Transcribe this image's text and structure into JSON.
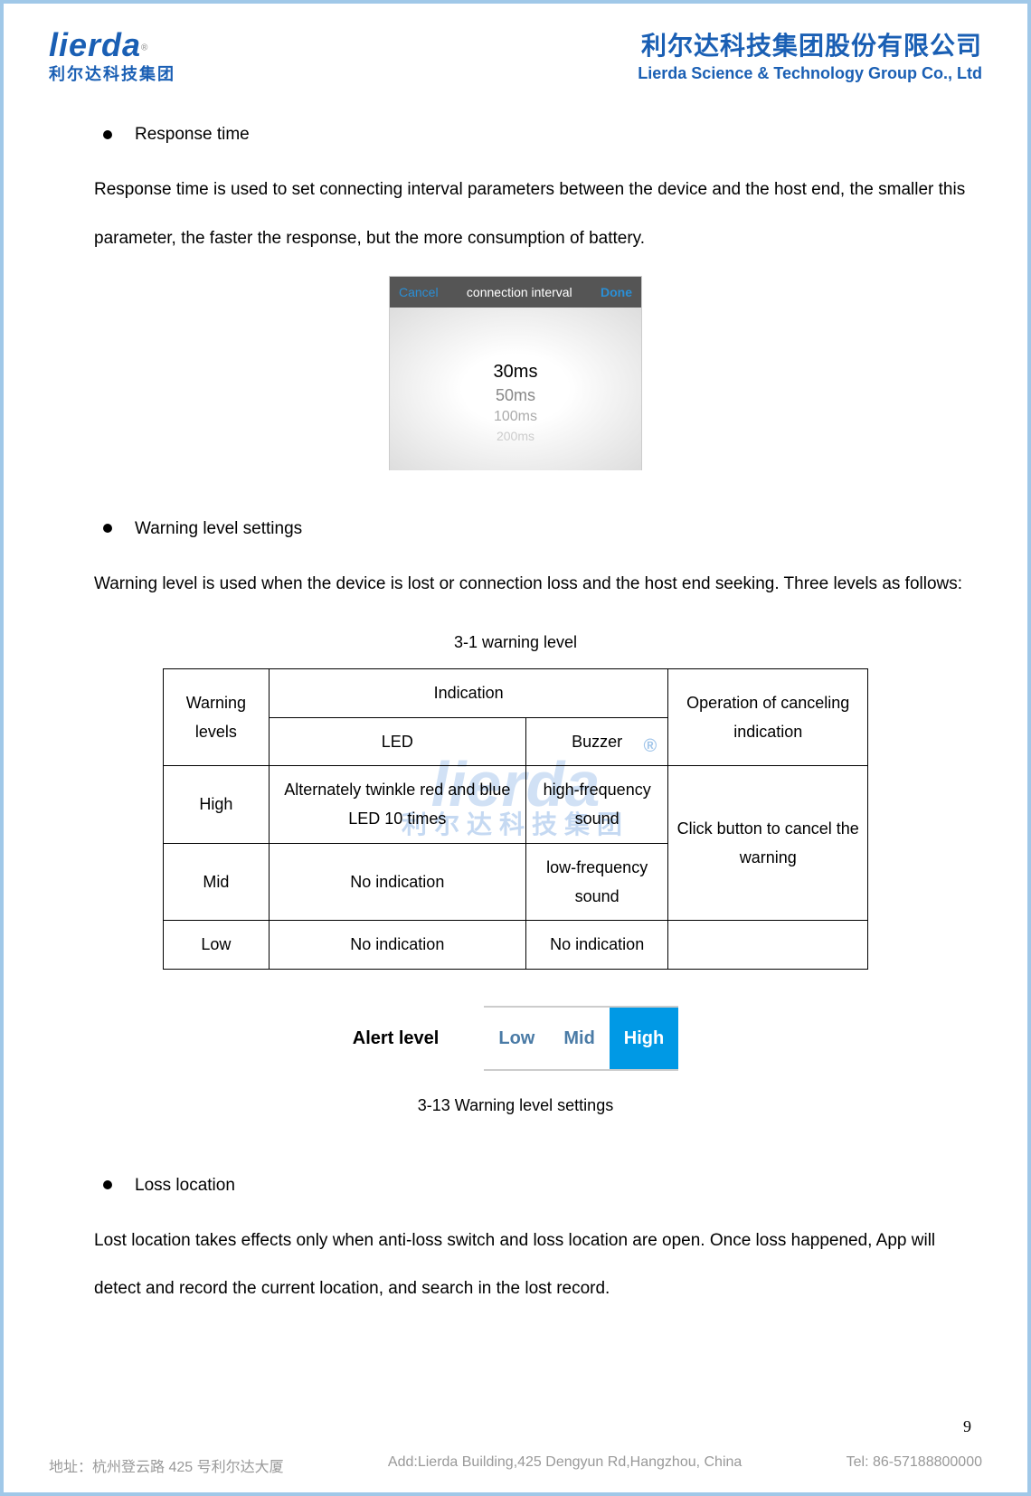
{
  "header": {
    "logo_text": "lierda",
    "logo_sub": "利尔达科技集团",
    "company_cn": "利尔达科技集团股份有限公司",
    "company_en": "Lierda Science & Technology Group Co., Ltd"
  },
  "section1": {
    "title": "Response time",
    "para": "Response time is used to set connecting interval parameters between the device and the host end, the smaller this parameter, the faster the response, but the more consumption of battery."
  },
  "phone": {
    "cancel": "Cancel",
    "title": "connection interval",
    "done": "Done",
    "options": [
      "30ms",
      "50ms",
      "100ms",
      "200ms"
    ]
  },
  "section2": {
    "title": "Warning level settings",
    "para": "Warning level is used when the device is lost or connection loss and the host end seeking. Three levels as follows:",
    "table_caption": "3-1   warning level",
    "table": {
      "headers": {
        "c1": "Warning levels",
        "c2": "Indication",
        "c2a": "LED",
        "c2b": "Buzzer",
        "c3": "Operation of canceling indication"
      },
      "rows": [
        {
          "level": "High",
          "led": "Alternately twinkle red and blue LED 10 times",
          "buzzer": "high-frequency sound",
          "op": "Click button to cancel the warning"
        },
        {
          "level": "Mid",
          "led": "No indication",
          "buzzer": "low-frequency sound"
        },
        {
          "level": "Low",
          "led": "No indication",
          "buzzer": "No indication",
          "op": ""
        }
      ]
    }
  },
  "alert": {
    "label": "Alert level",
    "low": "Low",
    "mid": "Mid",
    "high": "High"
  },
  "fig_caption": "3-13  Warning level settings",
  "section3": {
    "title": "Loss location",
    "para": "Lost location takes effects only when anti-loss switch and loss location are open. Once loss happened, App will detect and record the current location, and search in the lost record."
  },
  "page_num": "9",
  "footer": {
    "addr_cn": "地址：杭州登云路 425 号利尔达大厦",
    "addr_en": "Add:Lierda Building,425 Dengyun Rd,Hangzhou, China",
    "tel": "Tel: 86-57188800000"
  }
}
